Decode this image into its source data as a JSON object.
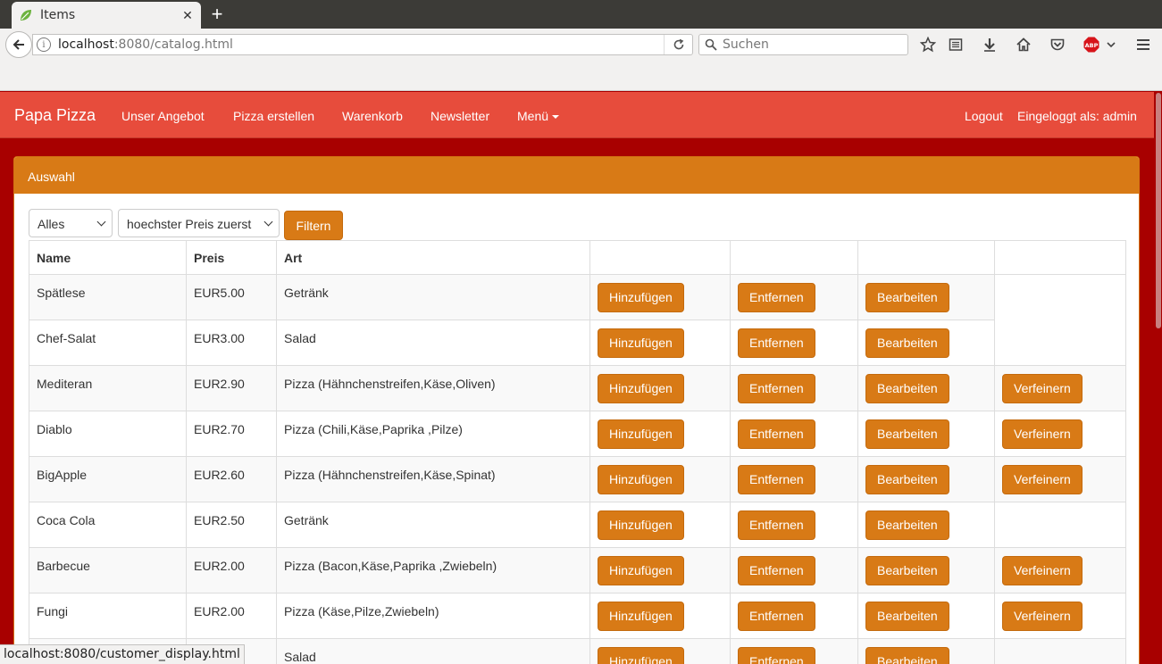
{
  "browser": {
    "tab_title": "Items",
    "url_host": "localhost",
    "url_rest": ":8080/catalog.html",
    "search_placeholder": "Suchen",
    "status_url": "localhost:8080/customer_display.html"
  },
  "nav": {
    "brand": "Papa Pizza",
    "links": [
      "Unser Angebot",
      "Pizza erstellen",
      "Warenkorb",
      "Newsletter",
      "Menü"
    ],
    "logout": "Logout",
    "logged_in": "Eingeloggt als: admin"
  },
  "panel": {
    "title": "Auswahl",
    "category_filter": "Alles",
    "sort_filter": "hoechster Preis zuerst",
    "filter_button": "Filtern"
  },
  "table": {
    "headers": [
      "Name",
      "Preis",
      "Art"
    ],
    "buttons": {
      "add": "Hinzufügen",
      "remove": "Entfernen",
      "edit": "Bearbeiten",
      "refine": "Verfeinern"
    },
    "rows": [
      {
        "name": "Spätlese",
        "price": "EUR5.00",
        "type": "Getränk"
      },
      {
        "name": "Chef-Salat",
        "price": "EUR3.00",
        "type": "Salad"
      },
      {
        "name": "Mediteran",
        "price": "EUR2.90",
        "type": "Pizza (Hähnchenstreifen,Käse,Oliven)"
      },
      {
        "name": "Diablo",
        "price": "EUR2.70",
        "type": "Pizza (Chili,Käse,Paprika ,Pilze)"
      },
      {
        "name": "BigApple",
        "price": "EUR2.60",
        "type": "Pizza (Hähnchenstreifen,Käse,Spinat)"
      },
      {
        "name": "Coca Cola",
        "price": "EUR2.50",
        "type": "Getränk"
      },
      {
        "name": "Barbecue",
        "price": "EUR2.00",
        "type": "Pizza (Bacon,Käse,Paprika ,Zwiebeln)"
      },
      {
        "name": "Fungi",
        "price": "EUR2.00",
        "type": "Pizza (Käse,Pilze,Zwiebeln)"
      },
      {
        "name": "",
        "price": "",
        "type": "Salad"
      }
    ]
  },
  "colors": {
    "navbar": "#e74c3c",
    "page_bg": "#a80000",
    "accent": "#d87a16"
  }
}
